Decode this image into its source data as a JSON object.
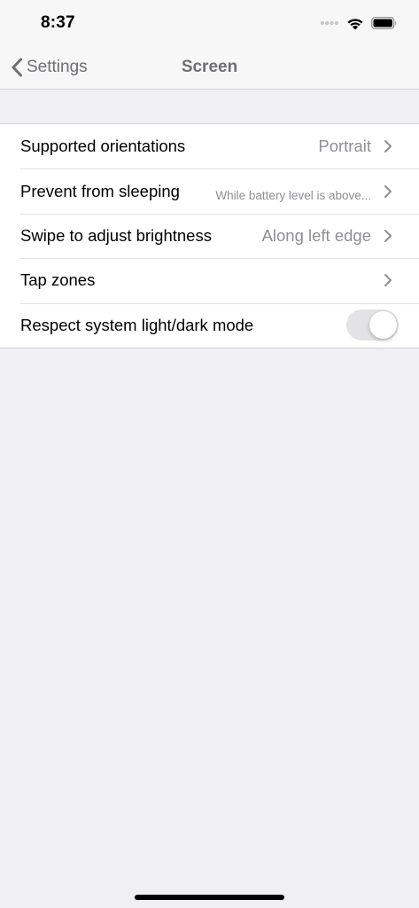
{
  "status_bar": {
    "time": "8:37",
    "icons": [
      "signal-dots-icon",
      "wifi-icon",
      "battery-icon"
    ]
  },
  "nav": {
    "back_label": "Settings",
    "title": "Screen"
  },
  "rows": [
    {
      "label": "Supported orientations",
      "value": "Portrait"
    },
    {
      "label": "Prevent from sleeping",
      "value": "While battery level is above..."
    },
    {
      "label": "Swipe to adjust brightness",
      "value": "Along left edge"
    },
    {
      "label": "Tap zones",
      "value": ""
    },
    {
      "label": "Respect system light/dark mode",
      "toggle_on": true
    }
  ],
  "colors": {
    "background": "#efeff4",
    "bar": "#f7f7f7",
    "secondary_text": "#8e8e93",
    "chevron": "#8e8e93",
    "toggle_track": "#e3e3e6"
  }
}
